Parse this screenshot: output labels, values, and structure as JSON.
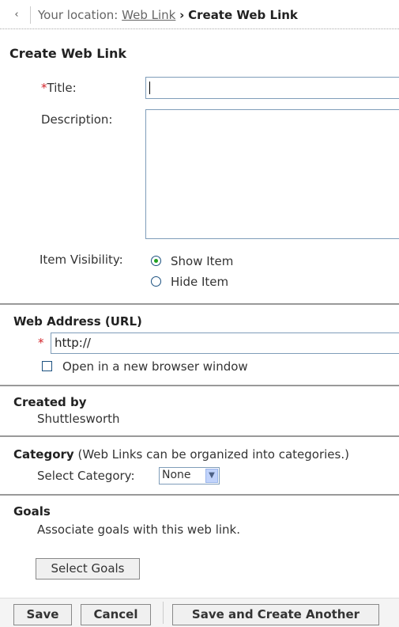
{
  "breadcrumb": {
    "prefix": "Your location:",
    "link": "Web Link",
    "separator": "›",
    "current": "Create Web Link"
  },
  "form": {
    "heading": "Create Web Link",
    "title_label": "Title:",
    "title_value": "",
    "description_label": "Description:",
    "description_value": "",
    "visibility_label": "Item Visibility:",
    "visibility_options": [
      {
        "label": "Show Item",
        "selected": true
      },
      {
        "label": "Hide Item",
        "selected": false
      }
    ],
    "required_marker": "*"
  },
  "web_address": {
    "heading": "Web Address (URL)",
    "url_value": "http://",
    "new_window_label": "Open in a new browser window",
    "new_window_checked": false
  },
  "created_by": {
    "heading": "Created by",
    "name": "Shuttlesworth"
  },
  "category": {
    "heading": "Category",
    "note": "(Web Links can be organized into categories.)",
    "select_label": "Select Category:",
    "selected": "None"
  },
  "goals": {
    "heading": "Goals",
    "description": "Associate goals with this web link.",
    "button": "Select Goals"
  },
  "actions": {
    "save": "Save",
    "cancel": "Cancel",
    "save_another": "Save and Create Another"
  },
  "colors": {
    "required": "#d2232a",
    "radio_selected": "#21a121",
    "input_border": "#7f9db9"
  }
}
